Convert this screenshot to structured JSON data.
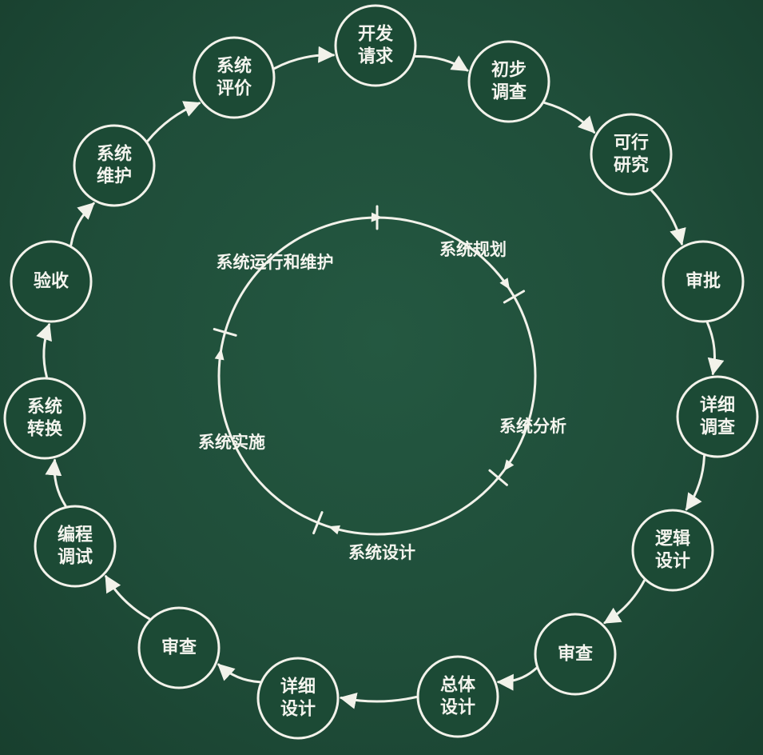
{
  "outer_cycle": {
    "nodes": [
      {
        "id": "dev-request",
        "lines": [
          "开发",
          "请求"
        ]
      },
      {
        "id": "preliminary-survey",
        "lines": [
          "初步",
          "调查"
        ]
      },
      {
        "id": "feasibility-study",
        "lines": [
          "可行",
          "研究"
        ]
      },
      {
        "id": "approval",
        "lines": [
          "审批"
        ]
      },
      {
        "id": "detailed-survey",
        "lines": [
          "详细",
          "调查"
        ]
      },
      {
        "id": "logical-design",
        "lines": [
          "逻辑",
          "设计"
        ]
      },
      {
        "id": "review-1",
        "lines": [
          "审查"
        ]
      },
      {
        "id": "overall-design",
        "lines": [
          "总体",
          "设计"
        ]
      },
      {
        "id": "detailed-design",
        "lines": [
          "详细",
          "设计"
        ]
      },
      {
        "id": "review-2",
        "lines": [
          "审查"
        ]
      },
      {
        "id": "coding-debugging",
        "lines": [
          "编程",
          "调试"
        ]
      },
      {
        "id": "system-conversion",
        "lines": [
          "系统",
          "转换"
        ]
      },
      {
        "id": "acceptance",
        "lines": [
          "验收"
        ]
      },
      {
        "id": "system-maintenance",
        "lines": [
          "系统",
          "维护"
        ]
      },
      {
        "id": "system-evaluation",
        "lines": [
          "系统",
          "评价"
        ]
      }
    ]
  },
  "inner_cycle": {
    "phases": [
      {
        "id": "system-planning",
        "label": "系统规划"
      },
      {
        "id": "system-analysis",
        "label": "系统分析"
      },
      {
        "id": "system-design",
        "label": "系统设计"
      },
      {
        "id": "system-implementation",
        "label": "系统实施"
      },
      {
        "id": "system-operation-maintenance",
        "label": "系统运行和维护"
      }
    ]
  },
  "colors": {
    "board": "#1f4d39",
    "chalk": "#f2f2ea"
  }
}
